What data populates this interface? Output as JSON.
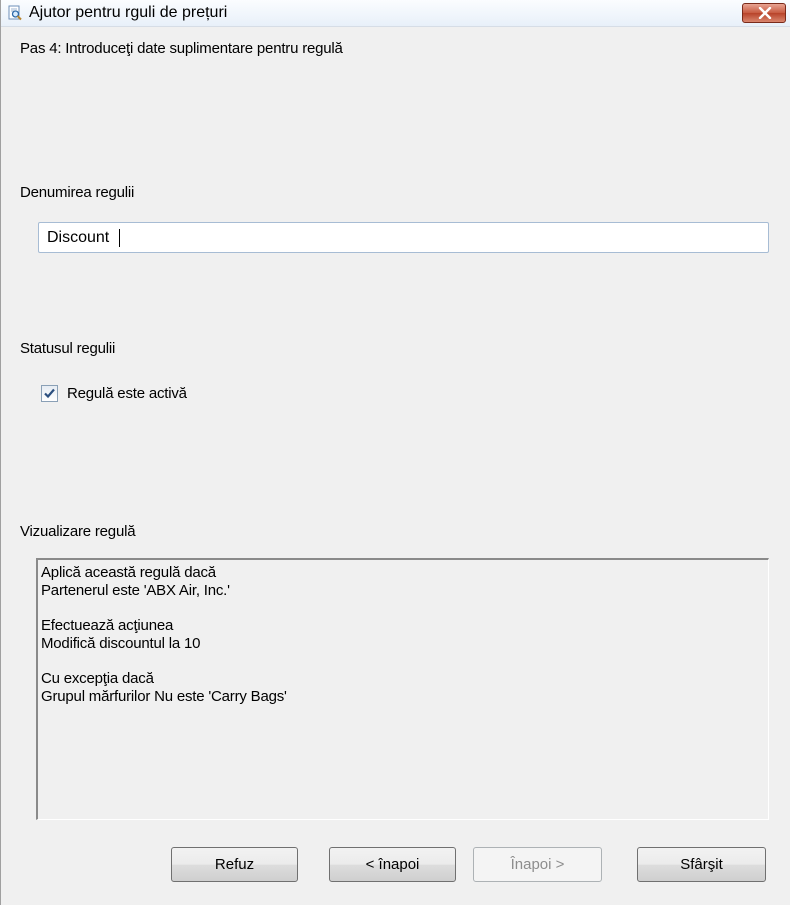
{
  "window": {
    "title": "Ajutor pentru rguli de prețuri",
    "step": "Pas 4: Introduceţi date suplimentare pentru regulă"
  },
  "rule_name": {
    "label": "Denumirea regulii",
    "value": "Discount"
  },
  "rule_status": {
    "label": "Statusul regulii",
    "checkbox_label": "Regulă este activă",
    "checked": true
  },
  "preview": {
    "label": "Vizualizare regulă",
    "lines": [
      "Aplică această regulă dacă",
      "Partenerul  este 'ABX Air, Inc.'",
      "",
      "Efectuează acţiunea",
      "Modifică discountul la 10",
      "",
      "Cu excepţia dacă",
      "Grupul mărfurilor Nu este 'Carry Bags'"
    ]
  },
  "buttons": {
    "cancel": "Refuz",
    "back": "< înapoi",
    "next": "Înapoi >",
    "finish": "Sfârşit"
  },
  "colors": {
    "window_bg": "#f0f0f0",
    "close_button": "#c75a40",
    "input_border": "#a7bcd4",
    "disabled_text": "#8d8d8d"
  },
  "icons": {
    "app": "wizard-magnifier-icon",
    "close": "close-x-icon",
    "check": "checkmark-icon"
  }
}
